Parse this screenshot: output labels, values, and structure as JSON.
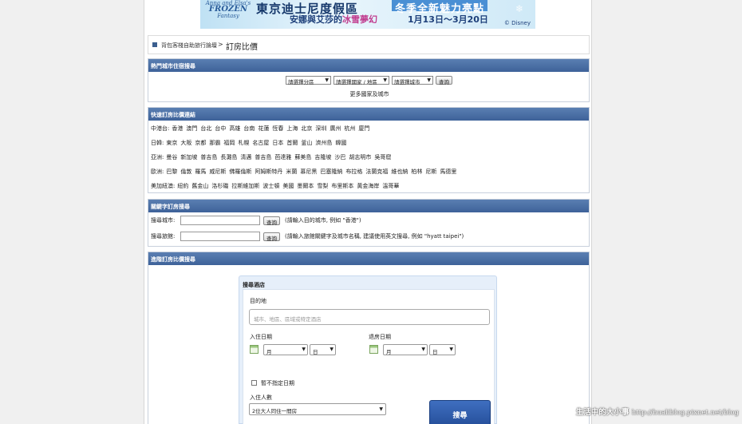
{
  "banner": {
    "logo_small": "Anna and Elsa's",
    "logo_main": "FROZEN",
    "logo_sub": "Fantasy",
    "title": "東京迪士尼度假區",
    "title_badge": "冬季全新魅力亮點",
    "subtitle_a": "安娜與艾莎的",
    "subtitle_b": "冰雪夢幻",
    "dates": "1月13日～3月20日",
    "copyright": "© Disney"
  },
  "breadcrumb": {
    "parent": "背包客棧自助旅行論壇",
    "separator": ">",
    "current": "訂房比價"
  },
  "popular": {
    "header": "熱門城市住宿搜尋",
    "region_select": "請選擇分區",
    "country_select": "請選擇國家 / 地區",
    "city_select": "請選擇城市",
    "query_button": "查詢",
    "more_link": "更多國家及城市"
  },
  "quick": {
    "header": "快速訂房比價連結",
    "rows": [
      {
        "label": "中港台:",
        "cities": [
          "香港",
          "澳門",
          "台北",
          "台中",
          "高雄",
          "台南",
          "花蓮",
          "恆春",
          "上海",
          "北京",
          "深圳",
          "廣州",
          "杭州",
          "廈門"
        ]
      },
      {
        "label": "日韓:",
        "cities": [
          "東京",
          "大阪",
          "京都",
          "那霸",
          "福岡",
          "札幌",
          "名古屋",
          "日本",
          "首爾",
          "釜山",
          "濟州島",
          "韓國"
        ]
      },
      {
        "label": "亞洲:",
        "cities": [
          "曼谷",
          "新加坡",
          "普吉島",
          "長灘島",
          "清邁",
          "普吉島",
          "芭達雅",
          "蘇美島",
          "吉隆坡",
          "沙巴",
          "胡志明市",
          "吳哥窟"
        ]
      },
      {
        "label": "歐洲:",
        "cities": [
          "巴黎",
          "倫敦",
          "羅馬",
          "威尼斯",
          "佛羅倫斯",
          "阿姆斯特丹",
          "米蘭",
          "慕尼黑",
          "巴塞隆納",
          "布拉格",
          "法蘭克福",
          "維也納",
          "柏林",
          "尼斯",
          "馬德里"
        ]
      },
      {
        "label": "美加紐澳:",
        "cities": [
          "紐約",
          "舊金山",
          "洛杉磯",
          "拉斯維加斯",
          "波士頓",
          "美國",
          "墨爾本",
          "雪梨",
          "布里斯本",
          "黃金海岸",
          "溫哥華"
        ]
      }
    ]
  },
  "keyword": {
    "header": "關鍵字訂房搜尋",
    "city_label": "搜尋城市:",
    "city_hint": "(請輸入目的城市, 例如 \"香港\")",
    "hotel_label": "搜尋旅館:",
    "hotel_hint": "(請輸入旅館關鍵字及城市名稱, 建議使用英文搜尋, 例如 \"hyatt taipei\")",
    "query_button": "查詢"
  },
  "advanced": {
    "header": "進階訂房比價搜尋",
    "panel_title": "搜尋酒店",
    "destination_label": "目的地",
    "destination_placeholder": "城市、地區、區域或特定酒店",
    "checkin_label": "入住日期",
    "checkout_label": "退房日期",
    "month_placeholder": "月",
    "day_placeholder": "日",
    "no_date_label": "暫不指定日期",
    "guests_label": "入住人數",
    "guests_value": "2位大人同住一間房",
    "search_button": "搜尋"
  },
  "watermark": {
    "text": "生活中的大小事",
    "url": "http://hualiblog.pixnet.net/blog"
  }
}
